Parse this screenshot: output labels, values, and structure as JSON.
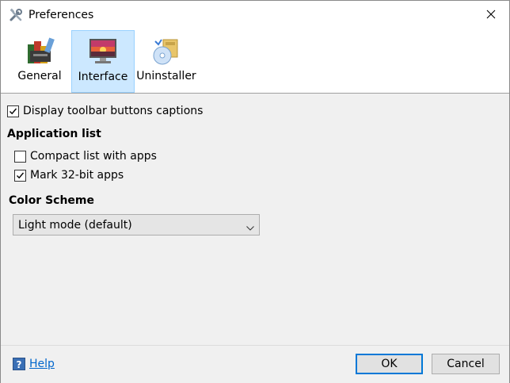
{
  "window": {
    "title": "Preferences"
  },
  "tabs": [
    {
      "label": "General",
      "icon": "books-icon",
      "selected": false
    },
    {
      "label": "Interface",
      "icon": "monitor-sunset-icon",
      "selected": true
    },
    {
      "label": "Uninstaller",
      "icon": "uninstall-cd-icon",
      "selected": false
    }
  ],
  "options": {
    "display_captions": {
      "label": "Display toolbar buttons captions",
      "checked": true
    },
    "application_list": {
      "title": "Application list",
      "compact": {
        "label": "Compact list with apps",
        "checked": false
      },
      "mark32": {
        "label": "Mark 32-bit apps",
        "checked": true
      }
    },
    "color_scheme": {
      "title": "Color Scheme",
      "selected": "Light mode (default)"
    }
  },
  "footer": {
    "help_label": "Help",
    "ok_label": "OK",
    "cancel_label": "Cancel"
  },
  "colors": {
    "accent": "#0078d7",
    "selected_tab": "#cce8ff",
    "link": "#0066cc",
    "panel": "#f0f0f0"
  }
}
